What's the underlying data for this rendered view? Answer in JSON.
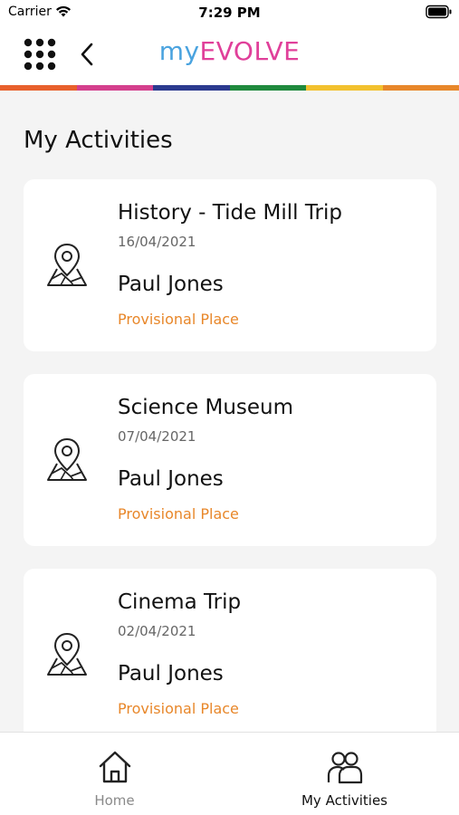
{
  "status_bar": {
    "carrier": "Carrier",
    "time": "7:29 PM",
    "wifi_icon": "wifi-icon",
    "battery_icon": "battery-icon"
  },
  "header": {
    "menu_icon": "grid-menu-icon",
    "back_icon": "chevron-left-icon",
    "title_part1": "my",
    "title_part2": "EVOLVE",
    "title_colors": {
      "my": "#4aa3df",
      "evolve": "#e0409a"
    },
    "stripe_colors": [
      "#e8602c",
      "#d43f8d",
      "#2b3a8f",
      "#1f8a3d",
      "#f2c12e",
      "#e8872a"
    ]
  },
  "main": {
    "page_title": "My Activities",
    "activities": [
      {
        "title": "History - Tide Mill Trip",
        "date": "16/04/2021",
        "person": "Paul Jones",
        "status": "Provisional Place",
        "icon": "map-pin-icon"
      },
      {
        "title": "Science Museum",
        "date": "07/04/2021",
        "person": "Paul Jones",
        "status": "Provisional Place",
        "icon": "map-pin-icon"
      },
      {
        "title": "Cinema Trip",
        "date": "02/04/2021",
        "person": "Paul Jones",
        "status": "Provisional Place",
        "icon": "map-pin-icon"
      }
    ],
    "status_color": "#e8872a"
  },
  "tab_bar": {
    "tabs": [
      {
        "label": "Home",
        "icon": "home-icon",
        "active": false
      },
      {
        "label": "My Activities",
        "icon": "users-icon",
        "active": true
      }
    ]
  }
}
